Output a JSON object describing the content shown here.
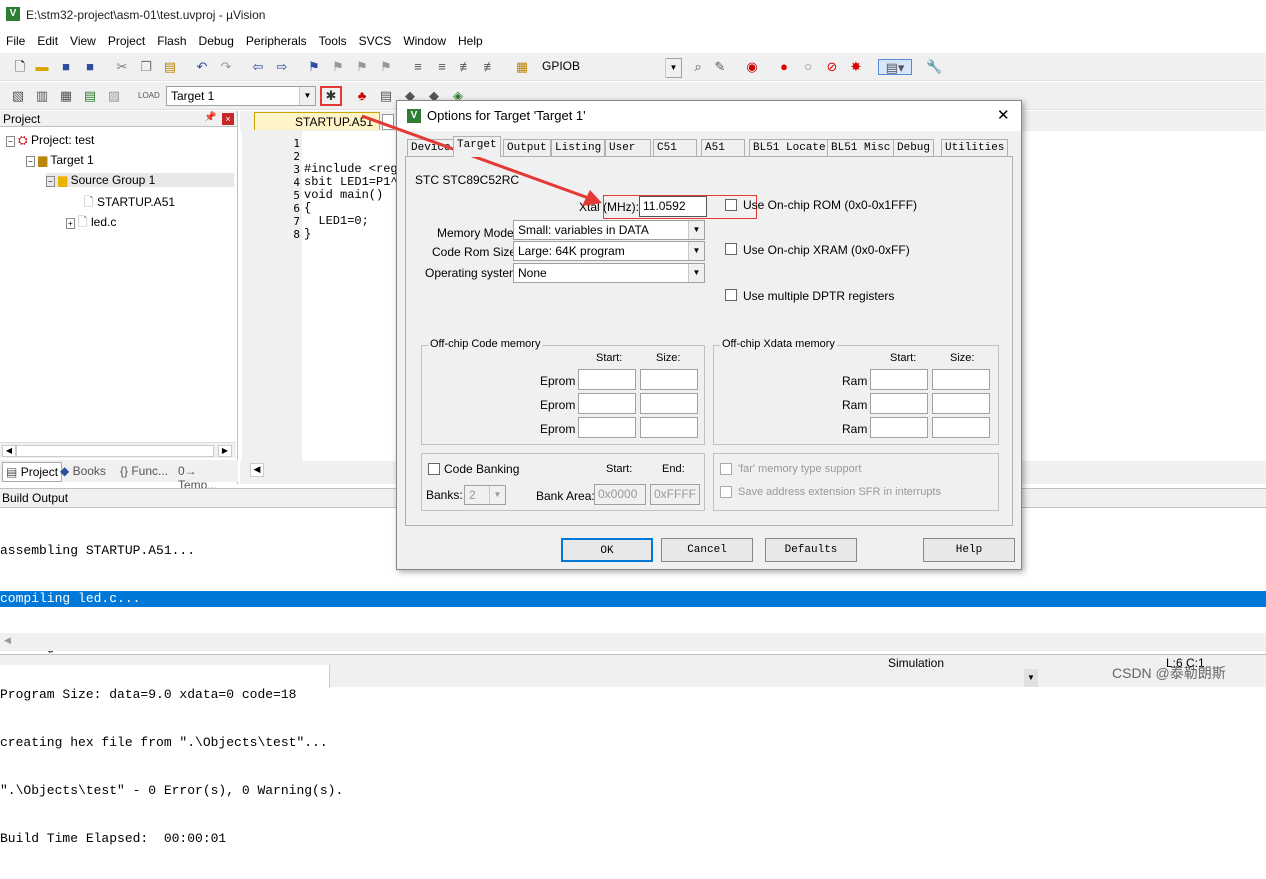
{
  "window": {
    "title": "E:\\stm32-project\\asm-01\\test.uvproj - µVision"
  },
  "menu": [
    "File",
    "Edit",
    "View",
    "Project",
    "Flash",
    "Debug",
    "Peripherals",
    "Tools",
    "SVCS",
    "Window",
    "Help"
  ],
  "toolbar1": {
    "find_combo": "GPIOB"
  },
  "toolbar2": {
    "target_combo": "Target 1"
  },
  "project_panel": {
    "header": "Project",
    "tree": [
      "Project: test",
      "Target 1",
      "Source Group 1",
      "STARTUP.A51",
      "led.c"
    ],
    "bottom_tabs": [
      "Project",
      "Books",
      "{} Func...",
      "0→ Temp..."
    ]
  },
  "editor": {
    "tab": "STARTUP.A51",
    "lines": [
      "1",
      "2",
      "3",
      "4",
      "5",
      "6",
      "7",
      "8"
    ],
    "code": [
      "#include <reg",
      "",
      "sbit LED1=P1^",
      "",
      "void main()",
      "{",
      "  LED1=0;",
      "}"
    ]
  },
  "build_output": {
    "header": "Build Output",
    "lines": [
      "assembling STARTUP.A51...",
      "compiling led.c...",
      "linking...",
      "Program Size: data=9.0 xdata=0 code=18",
      "creating hex file from \".\\Objects\\test\"...",
      "\".\\Objects\\test\" - 0 Error(s), 0 Warning(s).",
      "Build Time Elapsed:  00:00:01"
    ],
    "highlight_color": "#0078d7"
  },
  "status": {
    "mode": "Simulation",
    "pos": "L:6 C:1",
    "watermark": "CSDN @泰勒朗斯"
  },
  "dialog": {
    "title": "Options for Target 'Target 1'",
    "close": "✕",
    "tabs": [
      "Device",
      "Target",
      "Output",
      "Listing",
      "User",
      "C51",
      "A51",
      "BL51 Locate",
      "BL51 Misc",
      "Debug",
      "Utilities"
    ],
    "active_tab": "Target",
    "chip": "STC STC89C52RC",
    "xtal_label": "Xtal (MHz):",
    "xtal_value": "11.0592",
    "rom_check": "Use On-chip ROM (0x0-0x1FFF)",
    "xram_check": "Use On-chip XRAM (0x0-0xFF)",
    "dptr_check": "Use multiple DPTR registers",
    "memory_model_label": "Memory Model:",
    "memory_model": "Small: variables in DATA",
    "code_rom_label": "Code Rom Size:",
    "code_rom": "Large: 64K program",
    "os_label": "Operating system:",
    "os": "None",
    "offchip_code": {
      "title": "Off-chip Code memory",
      "start": "Start:",
      "size": "Size:",
      "rows": [
        "Eprom",
        "Eprom",
        "Eprom"
      ]
    },
    "offchip_xdata": {
      "title": "Off-chip Xdata memory",
      "start": "Start:",
      "size": "Size:",
      "rows": [
        "Ram",
        "Ram",
        "Ram"
      ]
    },
    "banking": {
      "label": "Code Banking",
      "start": "Start:",
      "end": "End:",
      "banks_label": "Banks:",
      "banks": "2",
      "bank_area": "Bank Area:",
      "start_val": "0x0000",
      "end_val": "0xFFFF"
    },
    "far_check": "'far' memory type support",
    "sfr_check": "Save address extension SFR in interrupts",
    "buttons": {
      "ok": "OK",
      "cancel": "Cancel",
      "defaults": "Defaults",
      "help": "Help"
    }
  },
  "colors": {
    "accent": "#0078d7",
    "annotation": "#e53935"
  }
}
